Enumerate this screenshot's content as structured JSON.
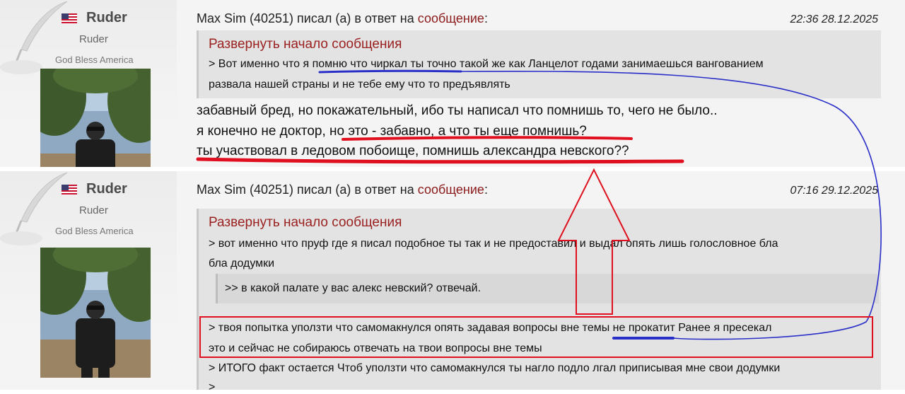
{
  "posts": [
    {
      "author": "Ruder",
      "role": "Ruder",
      "motto": "God Bless America",
      "header_prefix": "Max Sim (40251) писал (а) в ответ на ",
      "header_link": "сообщение",
      "header_suffix": ":",
      "datetime": "22:36 28.12.2025",
      "expand_label": "Развернуть начало сообщения",
      "quote_lines": [
        "> Вот именно что я помню что чиркал ты точно такой же как Ланцелот годами занимаешься вангованием",
        "развала нашей страны и не тебе ему что то предъявлять"
      ],
      "body_lines": [
        "забавный бред, но покажательный, ибо ты написал что помнишь то, чего не было..",
        "я конечно не доктор, но это - забавно, а что ты еще помнишь?",
        "ты участвовал в ледовом побоище, помнишь александра невского??"
      ]
    },
    {
      "author": "Ruder",
      "role": "Ruder",
      "motto": "God Bless America",
      "header_prefix": "Max Sim (40251) писал (а) в ответ на ",
      "header_link": "сообщение",
      "header_suffix": ":",
      "datetime": "07:16 29.12.2025",
      "expand_label": "Развернуть начало сообщения",
      "quote_lines": [
        "> вот именно что пруф где я писал подобное ты так и не предоставил и выдал опять лишь голословное бла",
        "бла додумки"
      ],
      "inner_quote": ">> в какой палате у вас алекс невский? отвечай.",
      "highlight_lines": [
        "> твоя попытка уползти что самомакнулся опять задавая вопросы вне темы не прокатит Ранее я пресекал",
        "это и сейчас не собираюсь отвечать на твои вопросы вне темы"
      ],
      "tail_lines": [
        "> ИТОГО факт остается Чтоб уползти что самомакнулся ты нагло подло лгал приписывая мне свои додумки",
        ">"
      ]
    }
  ],
  "colors": {
    "link": "#8b1a1a",
    "annotation_red": "#e01020",
    "annotation_blue": "#2a2fc8",
    "quote_bg": "#e3e3e3",
    "panel_bg": "#f4f4f4"
  }
}
